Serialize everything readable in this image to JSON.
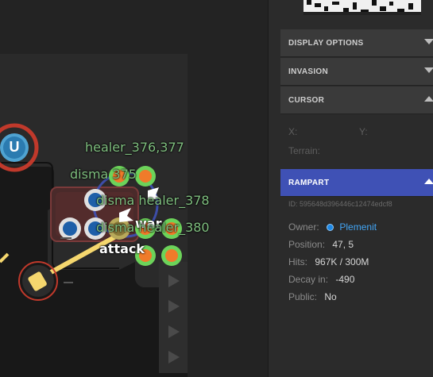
{
  "map": {
    "labels": {
      "healer_376_377": "healer_376,377",
      "disma_375": "disma 375",
      "disma_healer_378": "disma healer_378",
      "war": "war",
      "disma_healer_380": "disma healer_380",
      "attack": "attack"
    },
    "badge_letter": "U"
  },
  "panel": {
    "sections": {
      "display_options": "DISPLAY OPTIONS",
      "invasion": "INVASION",
      "cursor": "CURSOR",
      "rampart": "RAMPART"
    },
    "cursor": {
      "x_label": "X:",
      "y_label": "Y:",
      "terrain_label": "Terrain:"
    },
    "rampart": {
      "id": "ID: 595648d396446c12474edcf8",
      "owner_label": "Owner:",
      "owner_value": "Plemenit",
      "position_label": "Position:",
      "position_value": "47, 5",
      "hits_label": "Hits:",
      "hits_value": "967K / 300M",
      "decay_label": "Decay in:",
      "decay_value": "-490",
      "public_label": "Public:",
      "public_value": "No"
    }
  },
  "colors": {
    "accent": "#3f51b5",
    "owner": "#42a5f5",
    "creep_label": "#7fbf7f"
  }
}
